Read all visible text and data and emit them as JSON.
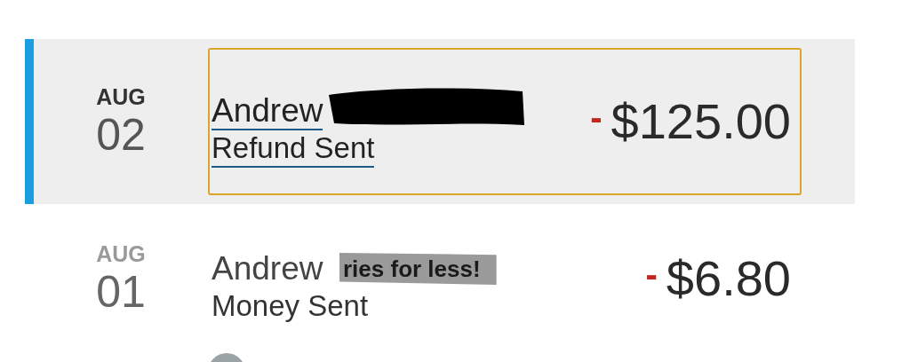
{
  "transactions": [
    {
      "month": "AUG",
      "day": "02",
      "name": "Andrew",
      "description": "Refund Sent",
      "sign": "-",
      "amount": "$125.00",
      "selected": true,
      "focused": true,
      "redaction": {
        "kind": "scribble"
      }
    },
    {
      "month": "AUG",
      "day": "01",
      "name": "Andrew",
      "description": "Money Sent",
      "sign": "-",
      "amount": "$6.80",
      "selected": false,
      "focused": false,
      "redaction": {
        "kind": "sticker",
        "text": "ries for less!"
      }
    }
  ],
  "next_row": {
    "kind": "avatar"
  }
}
